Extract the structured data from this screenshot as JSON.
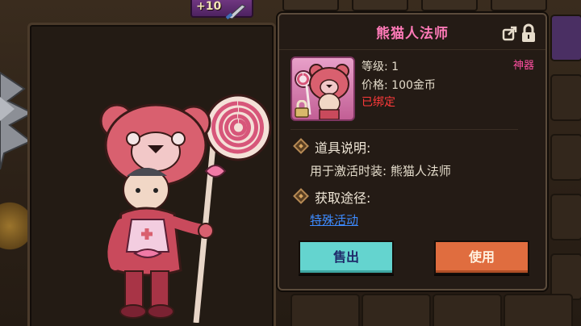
{
  "top_bar": {
    "enhance_level": "+10"
  },
  "item": {
    "name": "熊猫人法师",
    "rarity": "神器",
    "level_text": "等级: 1",
    "price_text": "价格: 100金币",
    "bound_text": "已绑定"
  },
  "description": {
    "heading": "道具说明:",
    "text": "用于激活时装: 熊猫人法师"
  },
  "source": {
    "heading": "获取途径:",
    "link_text": "特殊活动"
  },
  "buttons": {
    "sell": "售出",
    "use": "使用"
  },
  "colors": {
    "item_name": "#ff7ab8",
    "rarity": "#ff4fa2",
    "bound": "#ff3a3a",
    "link": "#3d8bff",
    "sell_button": "#64d4cf",
    "use_button": "#e06d3f"
  }
}
